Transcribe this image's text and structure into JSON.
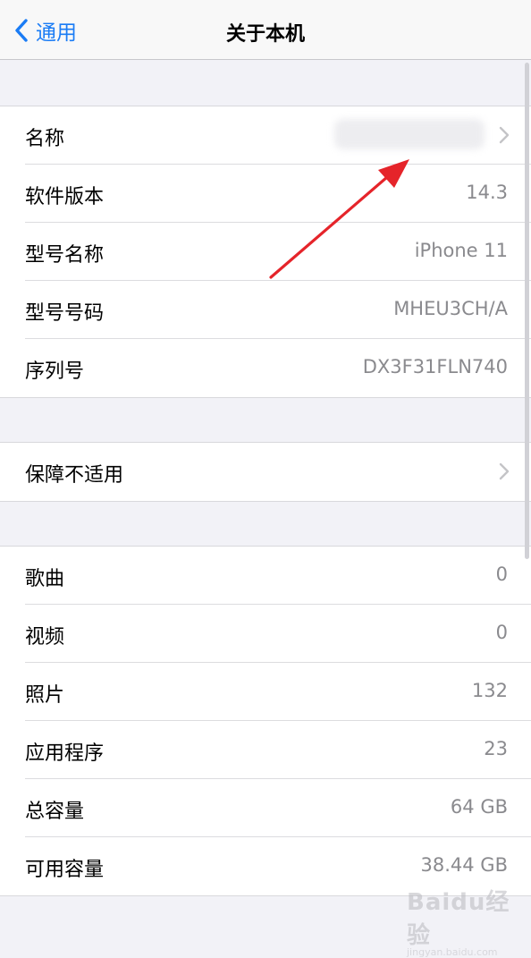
{
  "nav": {
    "back_label": "通用",
    "title": "关于本机"
  },
  "group1": [
    {
      "label": "名称",
      "value": ""
    },
    {
      "label": "软件版本",
      "value": "14.3"
    },
    {
      "label": "型号名称",
      "value": "iPhone 11"
    },
    {
      "label": "型号号码",
      "value": "MHEU3CH/A"
    },
    {
      "label": "序列号",
      "value": "DX3F31FLN740"
    }
  ],
  "group2": [
    {
      "label": "保障不适用"
    }
  ],
  "group3": [
    {
      "label": "歌曲",
      "value": "0"
    },
    {
      "label": "视频",
      "value": "0"
    },
    {
      "label": "照片",
      "value": "132"
    },
    {
      "label": "应用程序",
      "value": "23"
    },
    {
      "label": "总容量",
      "value": "64 GB"
    },
    {
      "label": "可用容量",
      "value": "38.44 GB"
    }
  ],
  "watermark": {
    "text": "Baidu经验",
    "sub": "jingyan.baidu.com"
  },
  "colors": {
    "accent": "#1a7cf5",
    "arrow": "#e5242a",
    "value_gray": "#8a8a8e"
  }
}
